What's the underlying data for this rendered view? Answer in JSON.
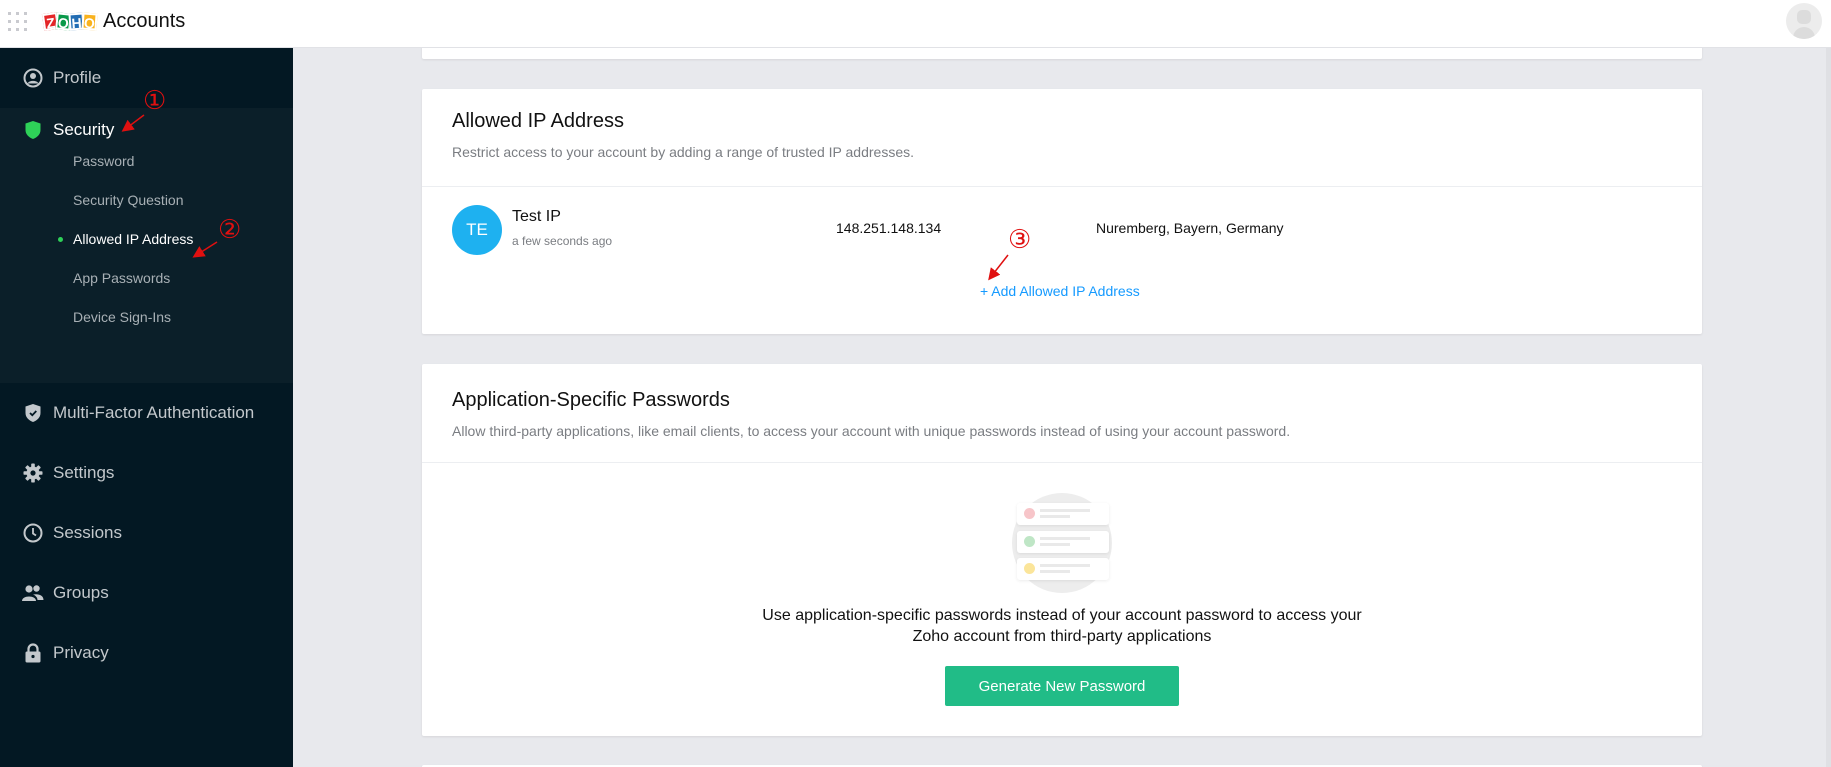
{
  "header": {
    "app_name": "Accounts",
    "logo_letters": [
      "Z",
      "O",
      "H",
      "O"
    ],
    "icons": {
      "apps": "apps-grid-icon",
      "avatar": "user-avatar-icon"
    }
  },
  "sidebar": {
    "items": [
      {
        "label": "Profile",
        "icon": "profile-icon"
      },
      {
        "label": "Security",
        "icon": "shield-icon",
        "active": true,
        "children": [
          {
            "label": "Password"
          },
          {
            "label": "Security Question"
          },
          {
            "label": "Allowed IP Address",
            "active": true
          },
          {
            "label": "App Passwords"
          },
          {
            "label": "Device Sign-Ins"
          }
        ]
      },
      {
        "label": "Multi-Factor Authentication",
        "icon": "shield-check-icon"
      },
      {
        "label": "Settings",
        "icon": "gear-icon"
      },
      {
        "label": "Sessions",
        "icon": "clock-icon"
      },
      {
        "label": "Groups",
        "icon": "groups-icon"
      },
      {
        "label": "Privacy",
        "icon": "lock-icon"
      }
    ],
    "accent": "#2ed158"
  },
  "allowed_ip": {
    "title": "Allowed IP Address",
    "description": "Restrict access to your account by adding a range of trusted IP addresses.",
    "entries": [
      {
        "initials": "TE",
        "name": "Test IP",
        "time": "a few seconds ago",
        "ip": "148.251.148.134",
        "location": "Nuremberg, Bayern, Germany"
      }
    ],
    "add_label": "+ Add Allowed IP Address"
  },
  "app_passwords": {
    "title": "Application-Specific Passwords",
    "description": "Allow third-party applications, like email clients, to access your account with unique passwords instead of using your account password.",
    "empty_line1": "Use application-specific passwords instead of your account password to access your",
    "empty_line2": "Zoho account from third-party applications",
    "button_label": "Generate New Password"
  },
  "annotations": [
    "①",
    "②",
    "③"
  ],
  "colors": {
    "sidebar_bg": "#031823",
    "security_bg": "#0b1f29",
    "link": "#159aff",
    "button": "#21bc87",
    "avatar": "#1eb1f0"
  }
}
